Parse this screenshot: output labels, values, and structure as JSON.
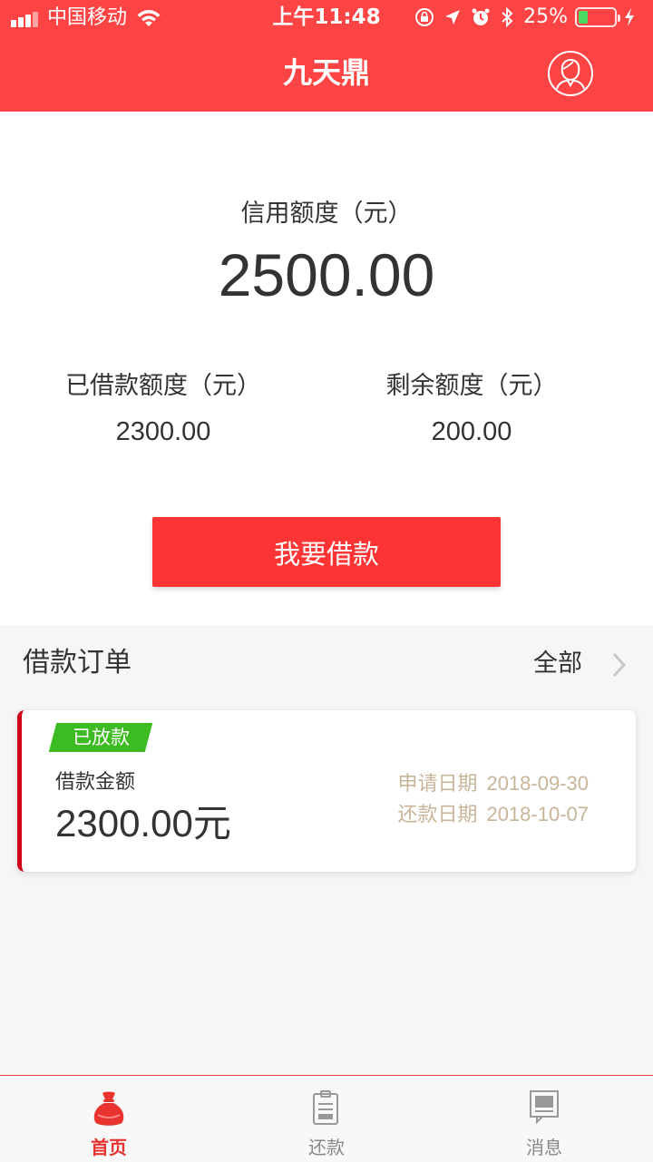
{
  "status_bar": {
    "carrier": "中国移动",
    "time": "上午11:48",
    "battery_percent": "25%",
    "battery_level": 0.25,
    "colors": {
      "battery_fill": "#4cd964"
    }
  },
  "nav": {
    "title": "九天鼎",
    "avatar_icon": "user-avatar-icon"
  },
  "credit": {
    "label": "信用额度（元）",
    "value": "2500.00",
    "borrowed_label": "已借款额度（元）",
    "borrowed_value": "2300.00",
    "remaining_label": "剩余额度（元）",
    "remaining_value": "200.00",
    "borrow_button": "我要借款"
  },
  "orders": {
    "title": "借款订单",
    "all_label": "全部",
    "items": [
      {
        "status": "已放款",
        "amount_label": "借款金额",
        "amount": "2300.00元",
        "apply_label": "申请日期",
        "apply_date": "2018-09-30",
        "repay_label": "还款日期",
        "repay_date": "2018-10-07"
      }
    ]
  },
  "tabbar": {
    "items": [
      {
        "label": "首页",
        "icon": "money-bag-icon",
        "active": true
      },
      {
        "label": "还款",
        "icon": "clipboard-icon",
        "active": false
      },
      {
        "label": "消息",
        "icon": "message-icon",
        "active": false
      }
    ]
  },
  "colors": {
    "brand": "#fd4444",
    "button": "#fd3434",
    "badge": "#3dbb22",
    "date_text": "#c8b59a",
    "card_accent": "#d0021b",
    "tab_active": "#e8332e"
  }
}
